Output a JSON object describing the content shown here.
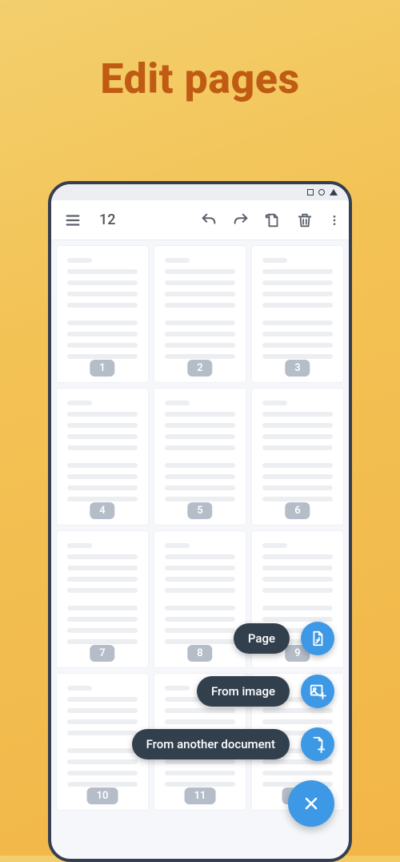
{
  "promo_title": "Edit pages",
  "toolbar": {
    "page_count": "12"
  },
  "pages": [
    "1",
    "2",
    "3",
    "4",
    "5",
    "6",
    "7",
    "8",
    "9",
    "10",
    "11",
    "12"
  ],
  "speeddial": {
    "page": "Page",
    "image": "From image",
    "doc": "From another document"
  }
}
